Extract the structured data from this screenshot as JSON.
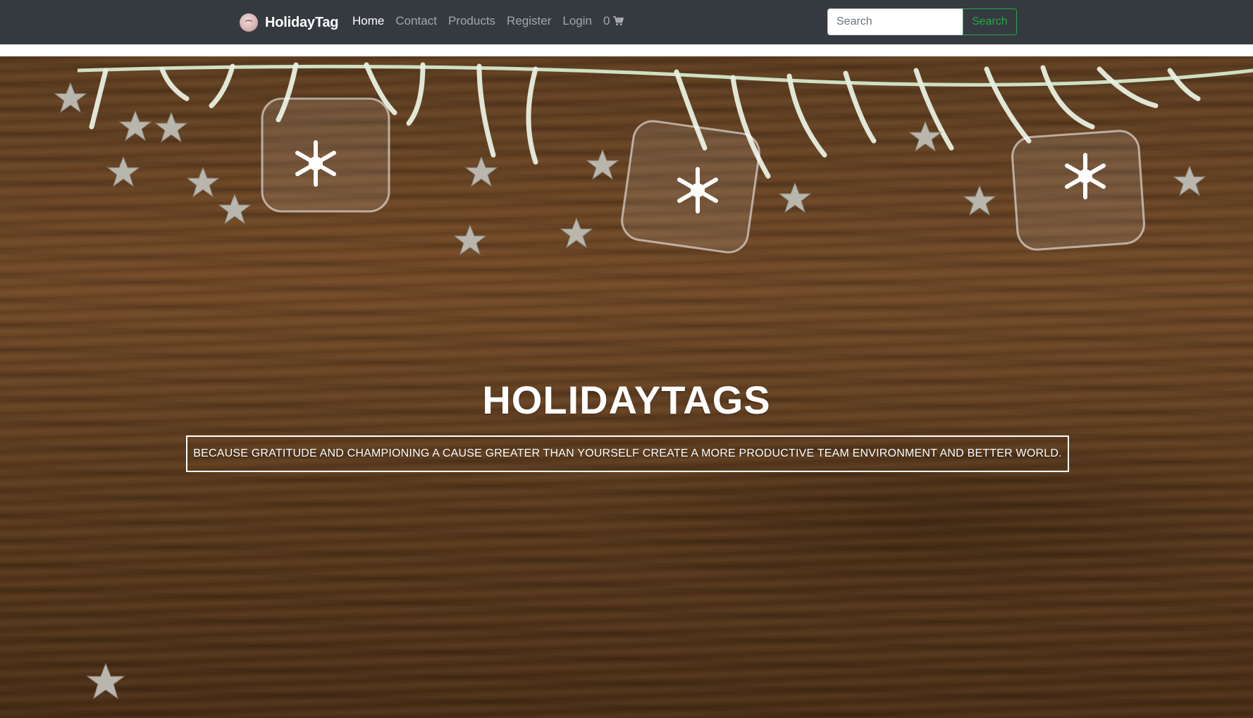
{
  "navbar": {
    "brand": "HolidayTag",
    "links": [
      {
        "label": "Home",
        "active": true
      },
      {
        "label": "Contact",
        "active": false
      },
      {
        "label": "Products",
        "active": false
      },
      {
        "label": "Register",
        "active": false
      },
      {
        "label": "Login",
        "active": false
      }
    ],
    "cart": {
      "count": "0",
      "icon": "shopping-cart-icon"
    },
    "search": {
      "placeholder": "Search",
      "button_label": "Search"
    }
  },
  "hero": {
    "title": "HOLIDAYTAGS",
    "tagline": "BECAUSE GRATITUDE AND CHAMPIONING A CAUSE GREATER THAN YOURSELF CREATE A MORE PRODUCTIVE TEAM ENVIRONMENT AND BETTER WORLD."
  },
  "colors": {
    "navbar_bg": "#343a40",
    "search_button": "#28a745",
    "wood": "#6f4827",
    "text_on_hero": "#ffffff"
  }
}
